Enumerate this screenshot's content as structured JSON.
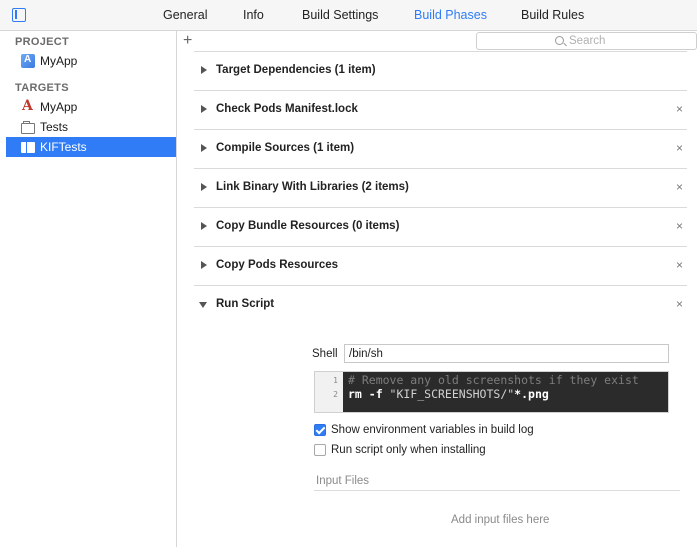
{
  "tabs": [
    {
      "label": "General"
    },
    {
      "label": "Info"
    },
    {
      "label": "Build Settings"
    },
    {
      "label": "Build Phases",
      "active": true
    },
    {
      "label": "Build Rules"
    }
  ],
  "sidebar": {
    "project_header": "PROJECT",
    "project_items": [
      {
        "label": "MyApp",
        "icon": "project-icon"
      }
    ],
    "targets_header": "TARGETS",
    "target_items": [
      {
        "label": "MyApp",
        "icon": "app-icon"
      },
      {
        "label": "Tests",
        "icon": "folder-icon"
      },
      {
        "label": "KIFTests",
        "icon": "bundle-icon",
        "selected": true
      }
    ]
  },
  "toolbar": {
    "add_label": "+",
    "search_placeholder": "Search"
  },
  "phases": [
    {
      "title": "Target Dependencies (1 item)",
      "closable": false,
      "expanded": false
    },
    {
      "title": "Check Pods Manifest.lock",
      "closable": true,
      "expanded": false
    },
    {
      "title": "Compile Sources (1 item)",
      "closable": true,
      "expanded": false
    },
    {
      "title": "Link Binary With Libraries (2 items)",
      "closable": true,
      "expanded": false
    },
    {
      "title": "Copy Bundle Resources (0 items)",
      "closable": true,
      "expanded": false
    },
    {
      "title": "Copy Pods Resources",
      "closable": true,
      "expanded": false
    },
    {
      "title": "Run Script",
      "closable": true,
      "expanded": true
    }
  ],
  "close_glyph": "×",
  "run_script": {
    "shell_label": "Shell",
    "shell_value": "/bin/sh",
    "code_lines": [
      {
        "num": "1",
        "comment": "# Remove any old screenshots if they exist"
      },
      {
        "num": "2",
        "cmd": "rm -f ",
        "str": "\"KIF_SCREENSHOTS/\"",
        "rest": "*.png"
      }
    ],
    "show_env_label": "Show environment variables in build log",
    "show_env_checked": true,
    "only_installing_label": "Run script only when installing",
    "only_installing_checked": false,
    "input_files_label": "Input Files",
    "add_input_hint": "Add input files here"
  },
  "colors": {
    "accent": "#2f7cf6",
    "code_bg": "#2b2b2b"
  }
}
